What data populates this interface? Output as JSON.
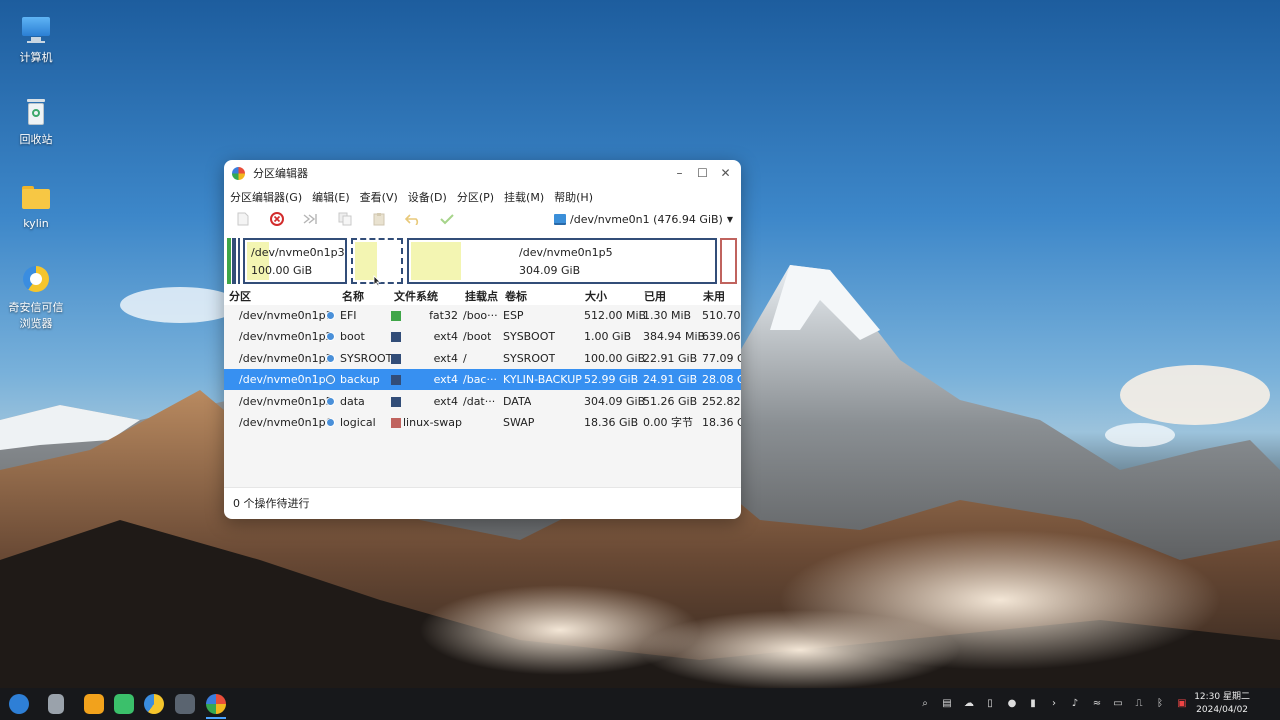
{
  "desktop": {
    "icons": [
      {
        "label": "计算机"
      },
      {
        "label": "回收站"
      },
      {
        "label": "kylin"
      },
      {
        "label": "奇安信可信\n浏览器"
      }
    ]
  },
  "window": {
    "title": "分区编辑器",
    "controls": {
      "minimize": "–",
      "maximize": "☐",
      "close": "✕"
    },
    "menu": [
      "分区编辑器(G)",
      "编辑(E)",
      "查看(V)",
      "设备(D)",
      "分区(P)",
      "挂载(M)",
      "帮助(H)"
    ],
    "device": "/dev/nvme0n1 (476.94 GiB)",
    "map": {
      "p3": {
        "name": "/dev/nvme0n1p3",
        "size": "100.00 GiB"
      },
      "p5": {
        "name": "/dev/nvme0n1p5",
        "size": "304.09 GiB"
      }
    },
    "columns": [
      "分区",
      "名称",
      "文件系统",
      "挂载点",
      "卷标",
      "大小",
      "已用",
      "未用"
    ],
    "rows": [
      {
        "partition": "/dev/nvme0n1p1",
        "name": "EFI",
        "fs": "fat32",
        "fs_color": "#3fa648",
        "mount": "/boo···",
        "label": "ESP",
        "size": "512.00 MiB",
        "used": "1.30 MiB",
        "unused": "510.70 M"
      },
      {
        "partition": "/dev/nvme0n1p2",
        "name": "boot",
        "fs": "ext4",
        "fs_color": "#324d78",
        "mount": "/boot",
        "label": "SYSBOOT",
        "size": "1.00 GiB",
        "used": "384.94 MiB",
        "unused": "639.06 M"
      },
      {
        "partition": "/dev/nvme0n1p3",
        "name": "SYSROOT",
        "fs": "ext4",
        "fs_color": "#324d78",
        "mount": "/",
        "label": "SYSROOT",
        "size": "100.00 GiB",
        "used": "22.91 GiB",
        "unused": "77.09 G"
      },
      {
        "partition": "/dev/nvme0n1p4",
        "name": "backup",
        "fs": "ext4",
        "fs_color": "#324d78",
        "mount": "/bac···",
        "label": "KYLIN-BACKUP",
        "size": "52.99 GiB",
        "used": "24.91 GiB",
        "unused": "28.08 G",
        "selected": true
      },
      {
        "partition": "/dev/nvme0n1p5",
        "name": "data",
        "fs": "ext4",
        "fs_color": "#324d78",
        "mount": "/dat···",
        "label": "DATA",
        "size": "304.09 GiB",
        "used": "51.26 GiB",
        "unused": "252.82 G"
      },
      {
        "partition": "/dev/nvme0n1p6",
        "name": "logical",
        "fs": "linux-swap",
        "fs_color": "#c0635e",
        "mount": "",
        "label": "SWAP",
        "size": "18.36 GiB",
        "used": "0.00 字节",
        "unused": "18.36 G"
      }
    ],
    "status": "0 个操作待进行"
  },
  "taskbar": {
    "time": "12:30 星期二",
    "date": "2024/04/02"
  }
}
